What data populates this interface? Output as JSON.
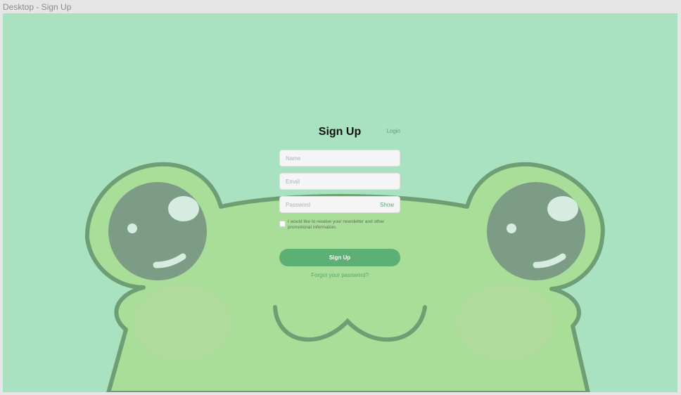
{
  "frame": {
    "label": "Desktop - Sign Up"
  },
  "signup": {
    "title": "Sign Up",
    "login_link": "Login",
    "name_placeholder": "Name",
    "email_placeholder": "Email",
    "password_placeholder": "Password",
    "show_label": "Show",
    "consent_text": "I would like to receive your newsletter and other promotional information.",
    "submit_label": "Sign Up",
    "forgot_link": "Forgot your password?"
  },
  "colors": {
    "background": "#a9e2c0",
    "frog_body": "#a8de98",
    "accent": "#5db073",
    "link": "#5aa66e"
  },
  "icons": {
    "background_art": "frog-illustration"
  }
}
